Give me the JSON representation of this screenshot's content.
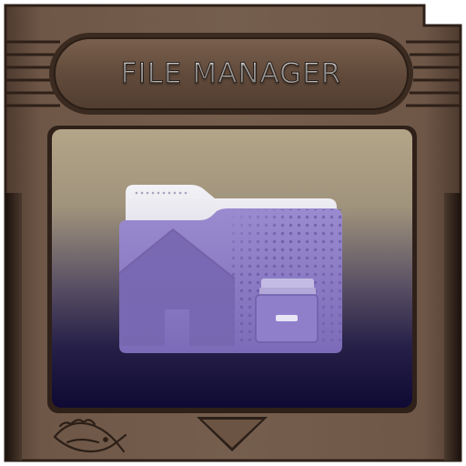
{
  "app": {
    "title": "FILE MANAGER",
    "icon": "folder-home-icon",
    "shell_icon": "game-cartridge-icon",
    "badge_icon": "fish-icon",
    "nav_icon": "down-triangle-icon"
  },
  "colors": {
    "cartridge": "#6e5645",
    "cartridge_dark": "#3d2c22",
    "label_frame": "#5b4637",
    "screen_top": "#aea084",
    "screen_bottom": "#100a35",
    "folder_main": "#8d7cc6",
    "folder_tab": "#e8e8ee",
    "title_text": "#d8d8d8"
  }
}
